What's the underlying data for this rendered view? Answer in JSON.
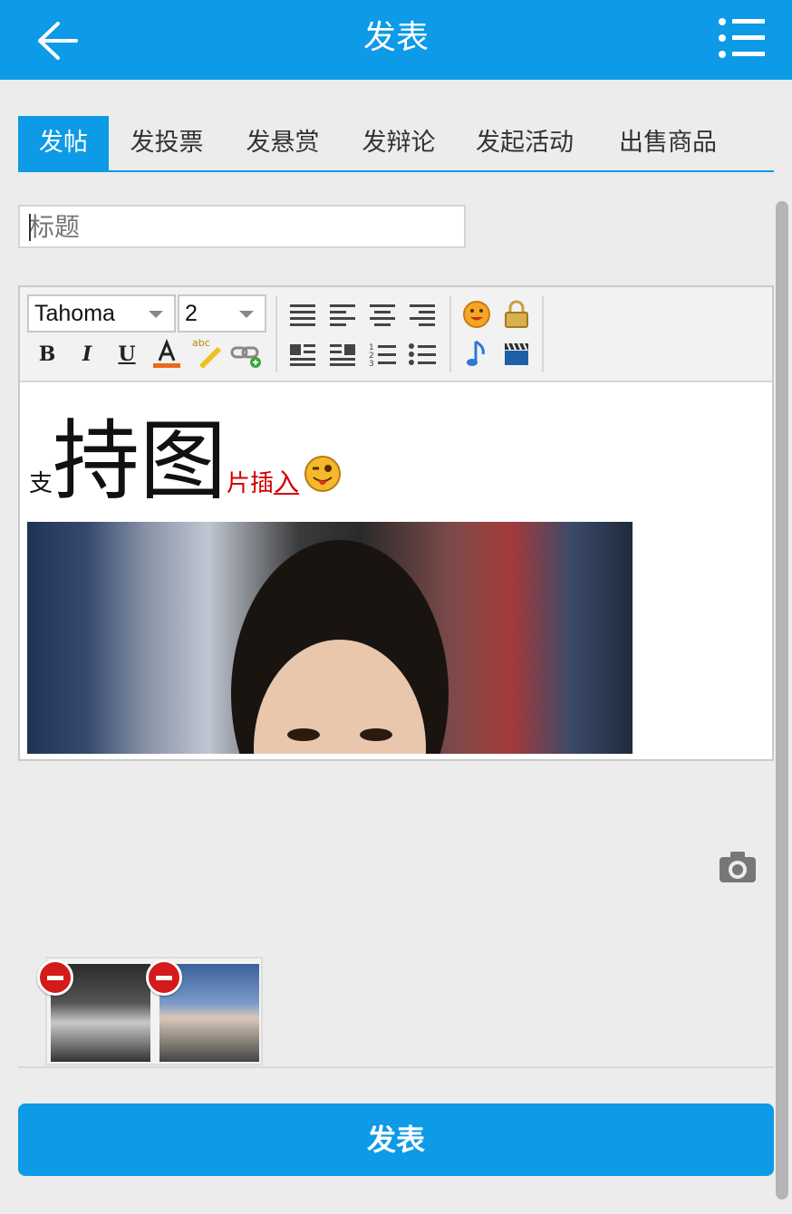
{
  "header": {
    "title": "发表",
    "back_icon": "arrow-left-icon",
    "menu_icon": "list-menu-icon"
  },
  "tabs": [
    {
      "label": "发帖",
      "active": true
    },
    {
      "label": "发投票",
      "active": false
    },
    {
      "label": "发悬赏",
      "active": false
    },
    {
      "label": "发辩论",
      "active": false
    },
    {
      "label": "发起活动",
      "active": false
    },
    {
      "label": "出售商品",
      "active": false
    }
  ],
  "title_input": {
    "placeholder": "标题",
    "value": ""
  },
  "editor": {
    "font_select": "Tahoma",
    "size_select": "2",
    "content": {
      "text_1": "支",
      "text_2": "持图",
      "text_3": "片插",
      "text_4": "入"
    }
  },
  "colors": {
    "accent": "#0d9ae6",
    "remove": "#d41a1a",
    "red_text": "#d40000"
  },
  "submit_label": "发表"
}
